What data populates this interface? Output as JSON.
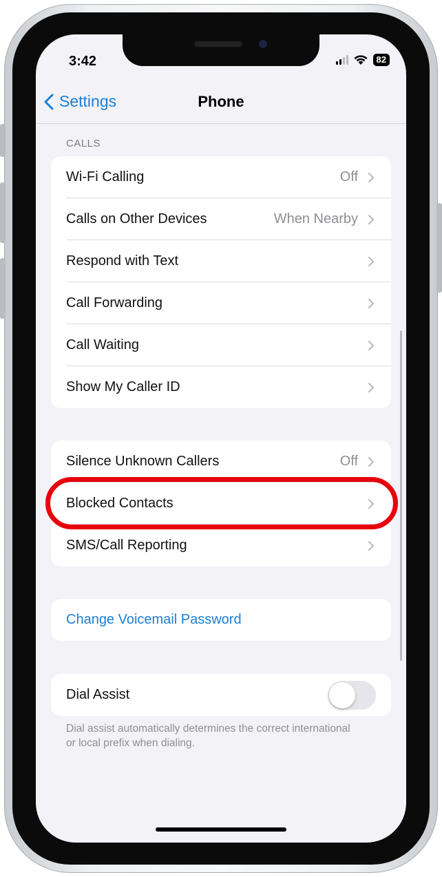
{
  "status_bar": {
    "time": "3:42",
    "battery": "82"
  },
  "nav": {
    "back_label": "Settings",
    "title": "Phone"
  },
  "calls_section": {
    "header": "CALLS",
    "rows": [
      {
        "label": "Wi-Fi Calling",
        "value": "Off"
      },
      {
        "label": "Calls on Other Devices",
        "value": "When Nearby"
      },
      {
        "label": "Respond with Text",
        "value": ""
      },
      {
        "label": "Call Forwarding",
        "value": ""
      },
      {
        "label": "Call Waiting",
        "value": ""
      },
      {
        "label": "Show My Caller ID",
        "value": ""
      }
    ]
  },
  "blocking_section": {
    "rows": [
      {
        "label": "Silence Unknown Callers",
        "value": "Off"
      },
      {
        "label": "Blocked Contacts",
        "value": ""
      },
      {
        "label": "SMS/Call Reporting",
        "value": ""
      }
    ]
  },
  "voicemail_section": {
    "link_label": "Change Voicemail Password"
  },
  "dial_assist_section": {
    "label": "Dial Assist",
    "toggle_on": false,
    "footer": "Dial assist automatically determines the correct international or local prefix when dialing."
  },
  "colors": {
    "accent": "#1a7fd6",
    "highlight": "#e8000b",
    "background": "#f2f2f7"
  }
}
